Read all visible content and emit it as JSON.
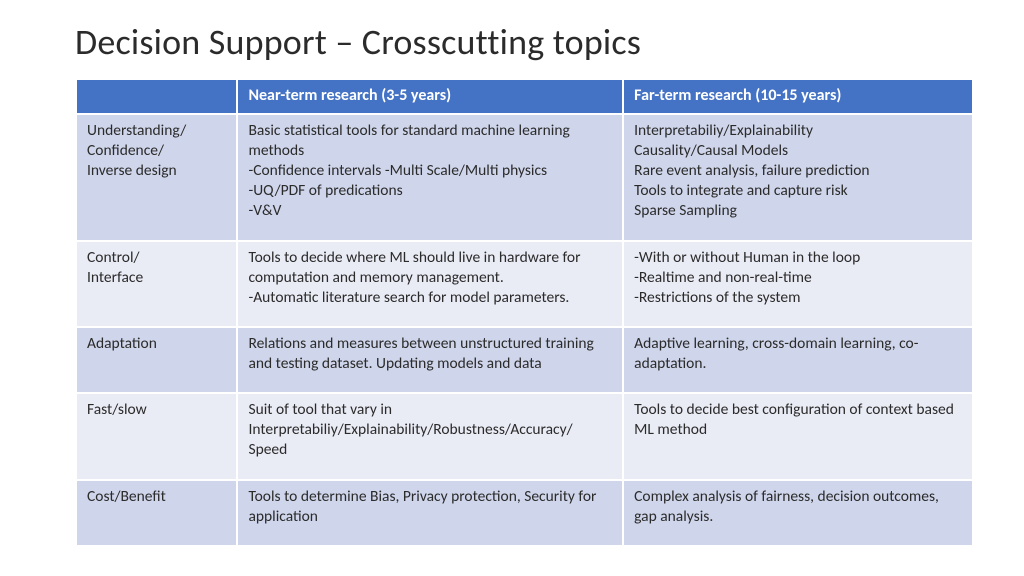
{
  "title": "Decision Support – Crosscutting topics",
  "headers": {
    "blank": "",
    "near": "Near-term research (3-5 years)",
    "far": "Far-term research (10-15 years)"
  },
  "rows": [
    {
      "topic": "Understanding/\nConfidence/\nInverse design",
      "near": "Basic statistical tools for standard machine learning methods\n-Confidence intervals  -Multi Scale/Multi physics\n-UQ/PDF of predications\n-V&V",
      "far": "Interpretabiliy/Explainability\nCausality/Causal Models\nRare event analysis, failure prediction\nTools to integrate and capture risk\nSparse Sampling"
    },
    {
      "topic": "Control/\nInterface",
      "near": "Tools to decide where ML should live in hardware for computation and memory management.\n-Automatic literature search for model parameters.",
      "far": "-With or without Human in the loop\n-Realtime and non-real-time\n-Restrictions of the system"
    },
    {
      "topic": "Adaptation",
      "near": "Relations and measures between unstructured training and testing dataset. Updating models and data",
      "far": "Adaptive learning, cross-domain learning, co-adaptation."
    },
    {
      "topic": "Fast/slow",
      "near": "Suit of tool that vary in Interpretabiliy/Explainability/Robustness/Accuracy/\nSpeed",
      "far": "Tools to decide best configuration of context based ML method"
    },
    {
      "topic": "Cost/Benefit",
      "near": "Tools to determine Bias, Privacy protection, Security for application",
      "far": "Complex analysis of fairness, decision outcomes, gap analysis."
    }
  ]
}
